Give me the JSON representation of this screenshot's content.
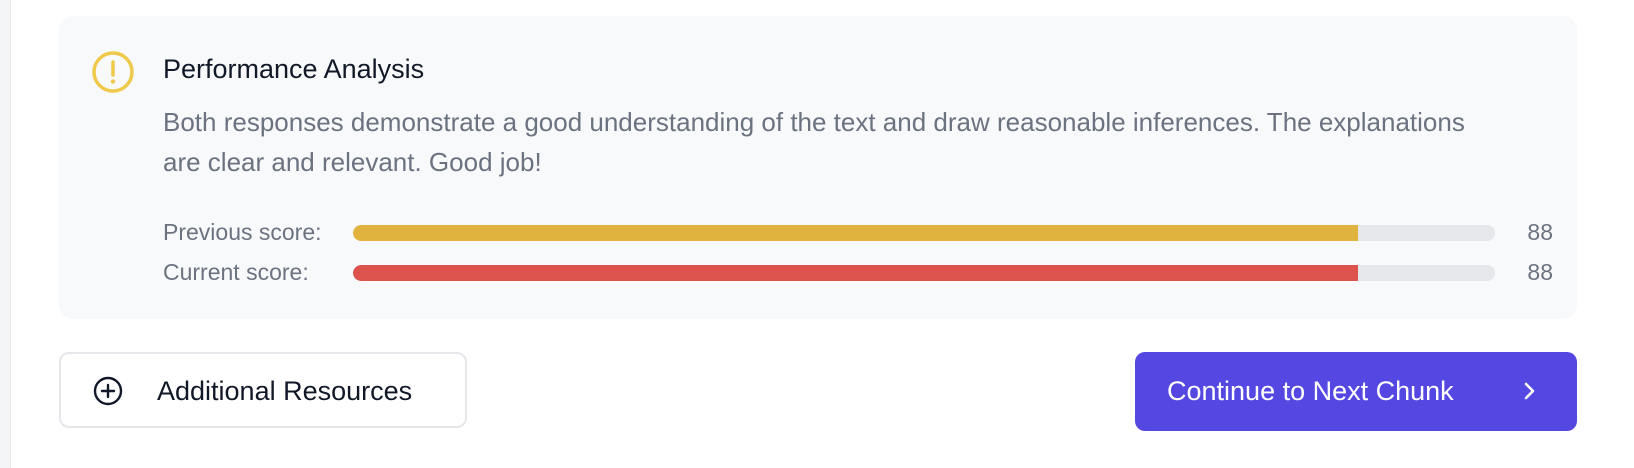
{
  "analysis": {
    "title": "Performance Analysis",
    "description": "Both responses demonstrate a good understanding of the text and draw reasonable inferences. The explanations are clear and relevant. Good job!",
    "icon": "warning-circle-icon",
    "icon_color": "#f0c94a",
    "scores": [
      {
        "label": "Previous score:",
        "value": "88",
        "percent": 88,
        "color": "#e0b23e"
      },
      {
        "label": "Current score:",
        "value": "88",
        "percent": 88,
        "color": "#dc524d"
      }
    ]
  },
  "actions": {
    "resources_label": "Additional Resources",
    "resources_icon": "plus-circle-icon",
    "next_label": "Continue to Next Chunk",
    "next_icon": "chevron-right-icon",
    "next_color": "#5548e2"
  }
}
